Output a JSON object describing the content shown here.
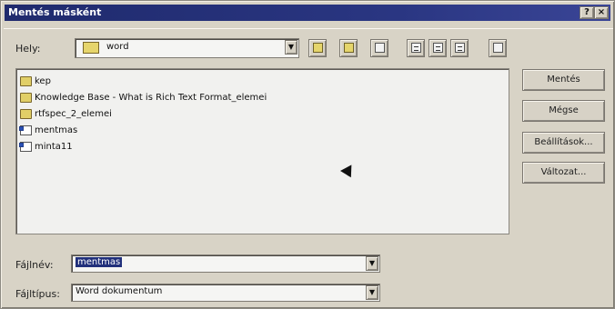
{
  "window": {
    "title": "Mentés másként"
  },
  "location": {
    "label": "Hely:",
    "folder_name": "word"
  },
  "toolbar": {
    "icons": [
      "up-folder-icon",
      "desktop-icon",
      "new-folder-icon",
      "list-view-icon",
      "details-view-icon",
      "properties-icon",
      "preview-icon"
    ]
  },
  "files": [
    {
      "name": "kep",
      "type": "folder"
    },
    {
      "name": "Knowledge Base - What is Rich Text Format_elemei",
      "type": "folder"
    },
    {
      "name": "rtfspec_2_elemei",
      "type": "folder"
    },
    {
      "name": "mentmas",
      "type": "document"
    },
    {
      "name": "minta11",
      "type": "document"
    }
  ],
  "buttons": {
    "save": "Mentés",
    "cancel": "Mégse",
    "settings": "Beállítások...",
    "version": "Változat..."
  },
  "filename": {
    "label": "Fájlnév:",
    "value": "mentmas"
  },
  "filetype": {
    "label": "Fájltípus:",
    "value": "Word dokumentum"
  },
  "title_buttons": {
    "help": "?",
    "close": "×"
  }
}
